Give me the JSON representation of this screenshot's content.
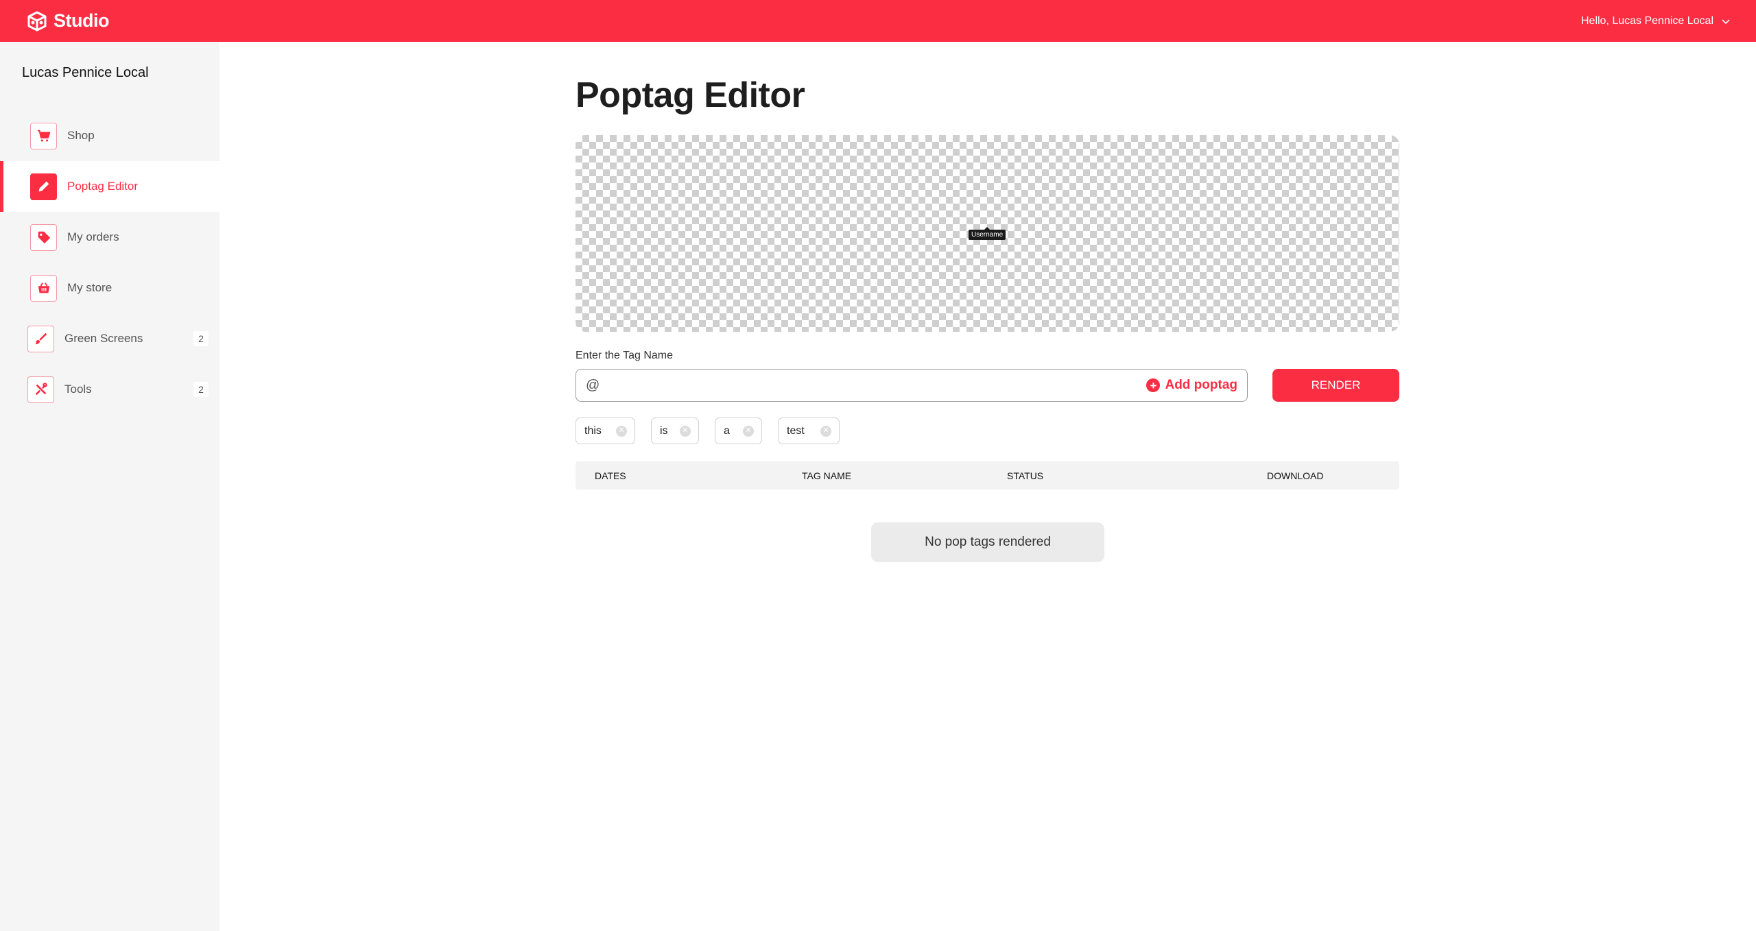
{
  "header": {
    "brand": "Studio",
    "greeting": "Hello, Lucas Pennice Local"
  },
  "sidebar": {
    "title": "Lucas Pennice Local",
    "items": [
      {
        "label": "Shop",
        "icon": "cart-icon",
        "active": false
      },
      {
        "label": "Poptag Editor",
        "icon": "pencil-icon",
        "active": true
      },
      {
        "label": "My orders",
        "icon": "tag-icon",
        "active": false
      },
      {
        "label": "My store",
        "icon": "basket-icon",
        "active": false
      },
      {
        "label": "Green Screens",
        "icon": "brush-icon",
        "active": false,
        "badge": "2"
      },
      {
        "label": "Tools",
        "icon": "tools-icon",
        "active": false,
        "badge": "2"
      }
    ]
  },
  "main": {
    "title": "Poptag Editor",
    "preview_tag": "Username",
    "field_label": "Enter the Tag Name",
    "input_value": "@",
    "add_label": "Add poptag",
    "render_label": "RENDER",
    "chips": [
      "this",
      "is",
      "a",
      "test"
    ],
    "table": {
      "columns": [
        "DATES",
        "TAG NAME",
        "STATUS",
        "DOWNLOAD"
      ]
    },
    "empty_text": "No pop tags rendered"
  },
  "colors": {
    "accent": "#fa2d43",
    "sidebar_bg": "#f5f5f5"
  }
}
